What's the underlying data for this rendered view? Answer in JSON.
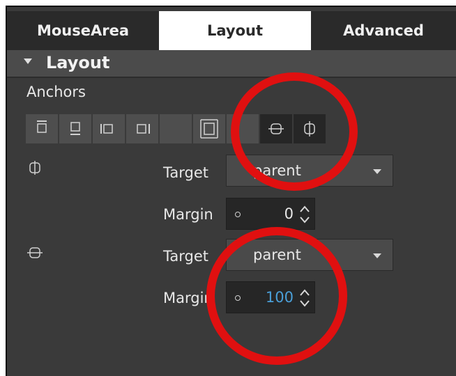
{
  "tabs": [
    {
      "label": "MouseArea"
    },
    {
      "label": "Layout"
    },
    {
      "label": "Advanced"
    }
  ],
  "section": {
    "title": "Layout"
  },
  "anchors": {
    "label": "Anchors"
  },
  "horizontal_center": {
    "target_label": "Target",
    "target_value": "parent",
    "margin_label": "Margin",
    "margin_value": "0"
  },
  "vertical_center": {
    "target_label": "Target",
    "target_value": "parent",
    "margin_label": "Margin",
    "margin_value": "100"
  },
  "colors": {
    "annotation": "#e01010",
    "highlight_value": "#4a9fd8"
  }
}
